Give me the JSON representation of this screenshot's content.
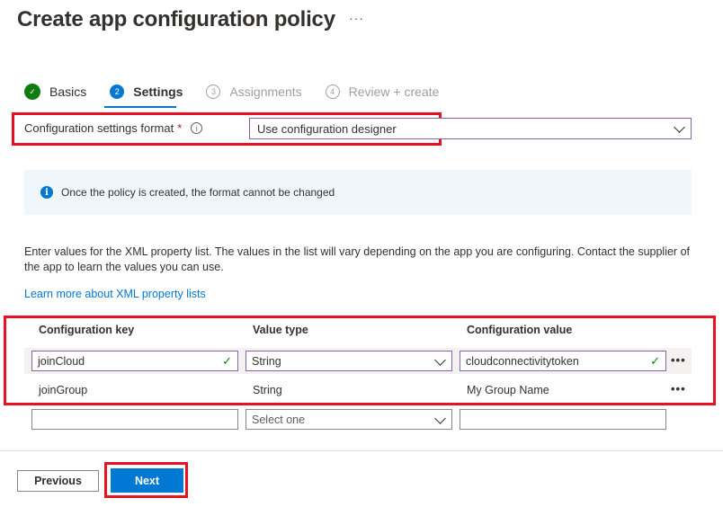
{
  "page": {
    "title": "Create app configuration policy",
    "more_label": "···"
  },
  "steps": [
    {
      "num": "✓",
      "label": "Basics",
      "state": "done"
    },
    {
      "num": "2",
      "label": "Settings",
      "state": "active"
    },
    {
      "num": "3",
      "label": "Assignments",
      "state": "pending"
    },
    {
      "num": "4",
      "label": "Review + create",
      "state": "pending"
    }
  ],
  "format": {
    "label": "Configuration settings format",
    "required_mark": "*",
    "info_glyph": "i",
    "selected": "Use configuration designer"
  },
  "info_banner": {
    "icon_glyph": "i",
    "text": "Once the policy is created, the format cannot be changed"
  },
  "description": "Enter values for the XML property list. The values in the list will vary depending on the app you are configuring. Contact the supplier of the app to learn the values you can use.",
  "learn_more": "Learn more about XML property lists",
  "table": {
    "headers": [
      "Configuration key",
      "Value type",
      "Configuration value"
    ],
    "rows": [
      {
        "key": "joinCloud",
        "type": "String",
        "value": "cloudconnectivitytoken",
        "menu": "•••"
      },
      {
        "key": "joinGroup",
        "type": "String",
        "value": "My Group Name",
        "menu": "•••"
      }
    ],
    "new_row": {
      "key": "",
      "type_placeholder": "Select one",
      "value": ""
    }
  },
  "footer": {
    "previous_label": "Previous",
    "next_label": "Next"
  },
  "colors": {
    "accent": "#0078d4",
    "success": "#107c10",
    "highlight_box": "#e81123"
  }
}
